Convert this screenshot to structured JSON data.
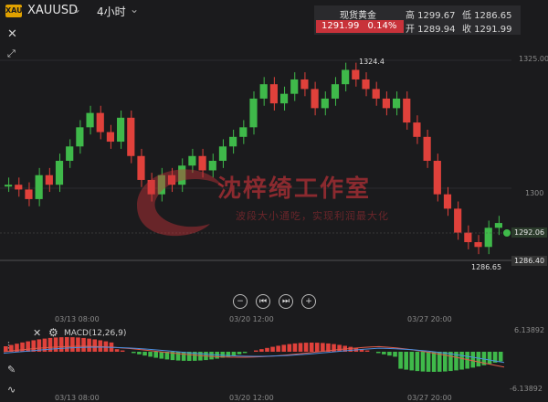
{
  "header": {
    "badge": "XAU",
    "symbol": "XAUUSD",
    "timeframe": "4小时"
  },
  "quote": {
    "name": "现货黄金",
    "price": "1291.99",
    "change": "0.14%",
    "high": "高 1299.67",
    "low": "低 1286.65",
    "open": "开 1289.94",
    "close": "收 1291.99"
  },
  "axis": {
    "price_ticks": [
      "1325.00",
      "1300"
    ],
    "time_ticks": [
      "03/13 08:00",
      "03/20 12:00",
      "03/27 20:00"
    ],
    "max_label": "1324.4",
    "min_label": "1286.65",
    "current_tag": "1292.06",
    "cross_tag": "1286.40"
  },
  "macd": {
    "label": "MACD(12,26,9)",
    "top_value": "6.13892",
    "bottom_value": "-6.13892"
  },
  "watermark": {
    "title": "沈梓绮工作室",
    "subtitle": "波段大小通吃，实现利润最大化"
  },
  "colors": {
    "up": "#3fb94a",
    "down": "#e0413b",
    "background": "#1b1b1d",
    "dif_line": "#e05b4b",
    "dea_line": "#4b8fe0"
  },
  "icons": [
    "close-icon",
    "expand-icon",
    "zoom-out-icon",
    "rewind-icon",
    "forward-icon",
    "zoom-in-icon",
    "settings-icon",
    "chart-type-icon",
    "draw-icon",
    "wave-icon"
  ]
}
